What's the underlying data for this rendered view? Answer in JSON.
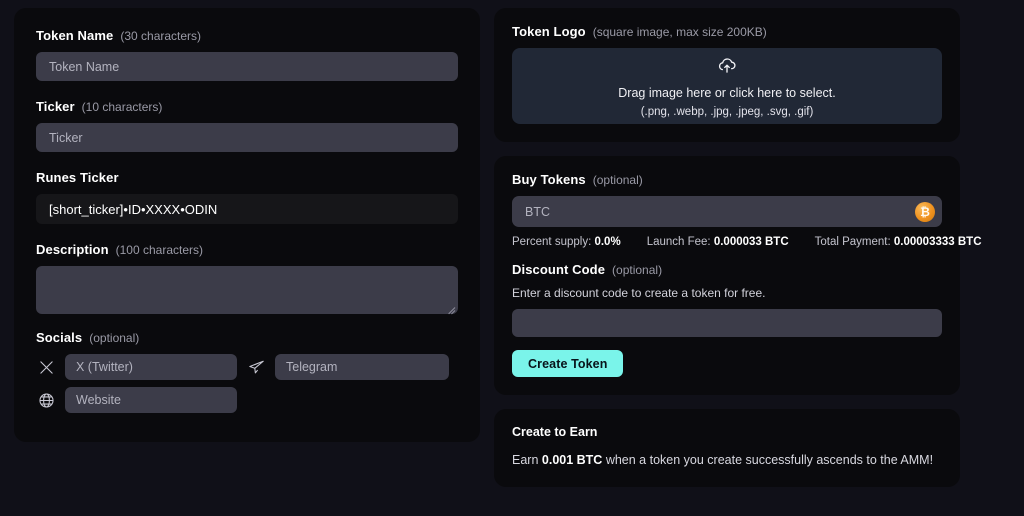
{
  "form": {
    "token_name": {
      "label": "Token Name",
      "hint": "(30 characters)",
      "placeholder": "Token Name"
    },
    "ticker": {
      "label": "Ticker",
      "hint": "(10 characters)",
      "placeholder": "Ticker"
    },
    "runes_ticker": {
      "label": "Runes Ticker",
      "value": "[short_ticker]•ID•XXXX•ODIN"
    },
    "description": {
      "label": "Description",
      "hint": "(100 characters)",
      "value": ""
    },
    "socials": {
      "label": "Socials",
      "hint": "(optional)",
      "fields": [
        {
          "icon": "x-twitter-icon",
          "placeholder": "X (Twitter)"
        },
        {
          "icon": "telegram-icon",
          "placeholder": "Telegram"
        },
        {
          "icon": "globe-icon",
          "placeholder": "Website"
        }
      ]
    }
  },
  "logo": {
    "label": "Token Logo",
    "hint": "(square image, max size 200KB)",
    "dropzone_icon": "cloud-upload-icon",
    "dropzone_line1": "Drag image here or click here to select.",
    "dropzone_line2": "(.png, .webp, .jpg, .jpeg, .svg, .gif)"
  },
  "buy": {
    "label": "Buy Tokens",
    "hint": "(optional)",
    "amount_placeholder": "BTC",
    "currency_icon": "bitcoin-icon",
    "currency_symbol": "₿",
    "fees": [
      {
        "label": "Percent supply:",
        "value": "0.0%"
      },
      {
        "label": "Launch Fee:",
        "value": "0.000033 BTC"
      },
      {
        "label": "Total Payment:",
        "value": "0.00003333 BTC"
      }
    ]
  },
  "discount": {
    "label": "Discount Code",
    "hint": "(optional)",
    "note": "Enter a discount code to create a token for free.",
    "value": "",
    "submit_label": "Create Token"
  },
  "earn": {
    "title": "Create to Earn",
    "text_before": "Earn ",
    "amount": "0.001 BTC",
    "text_after": " when a token you create successfully ascends to the AMM!"
  },
  "colors": {
    "background": "#101018",
    "panel": "#0a0a0d",
    "input": "#3c3c49",
    "dropzone": "#212836",
    "accent": "#7af4ea",
    "bitcoin": "#f0921e"
  }
}
